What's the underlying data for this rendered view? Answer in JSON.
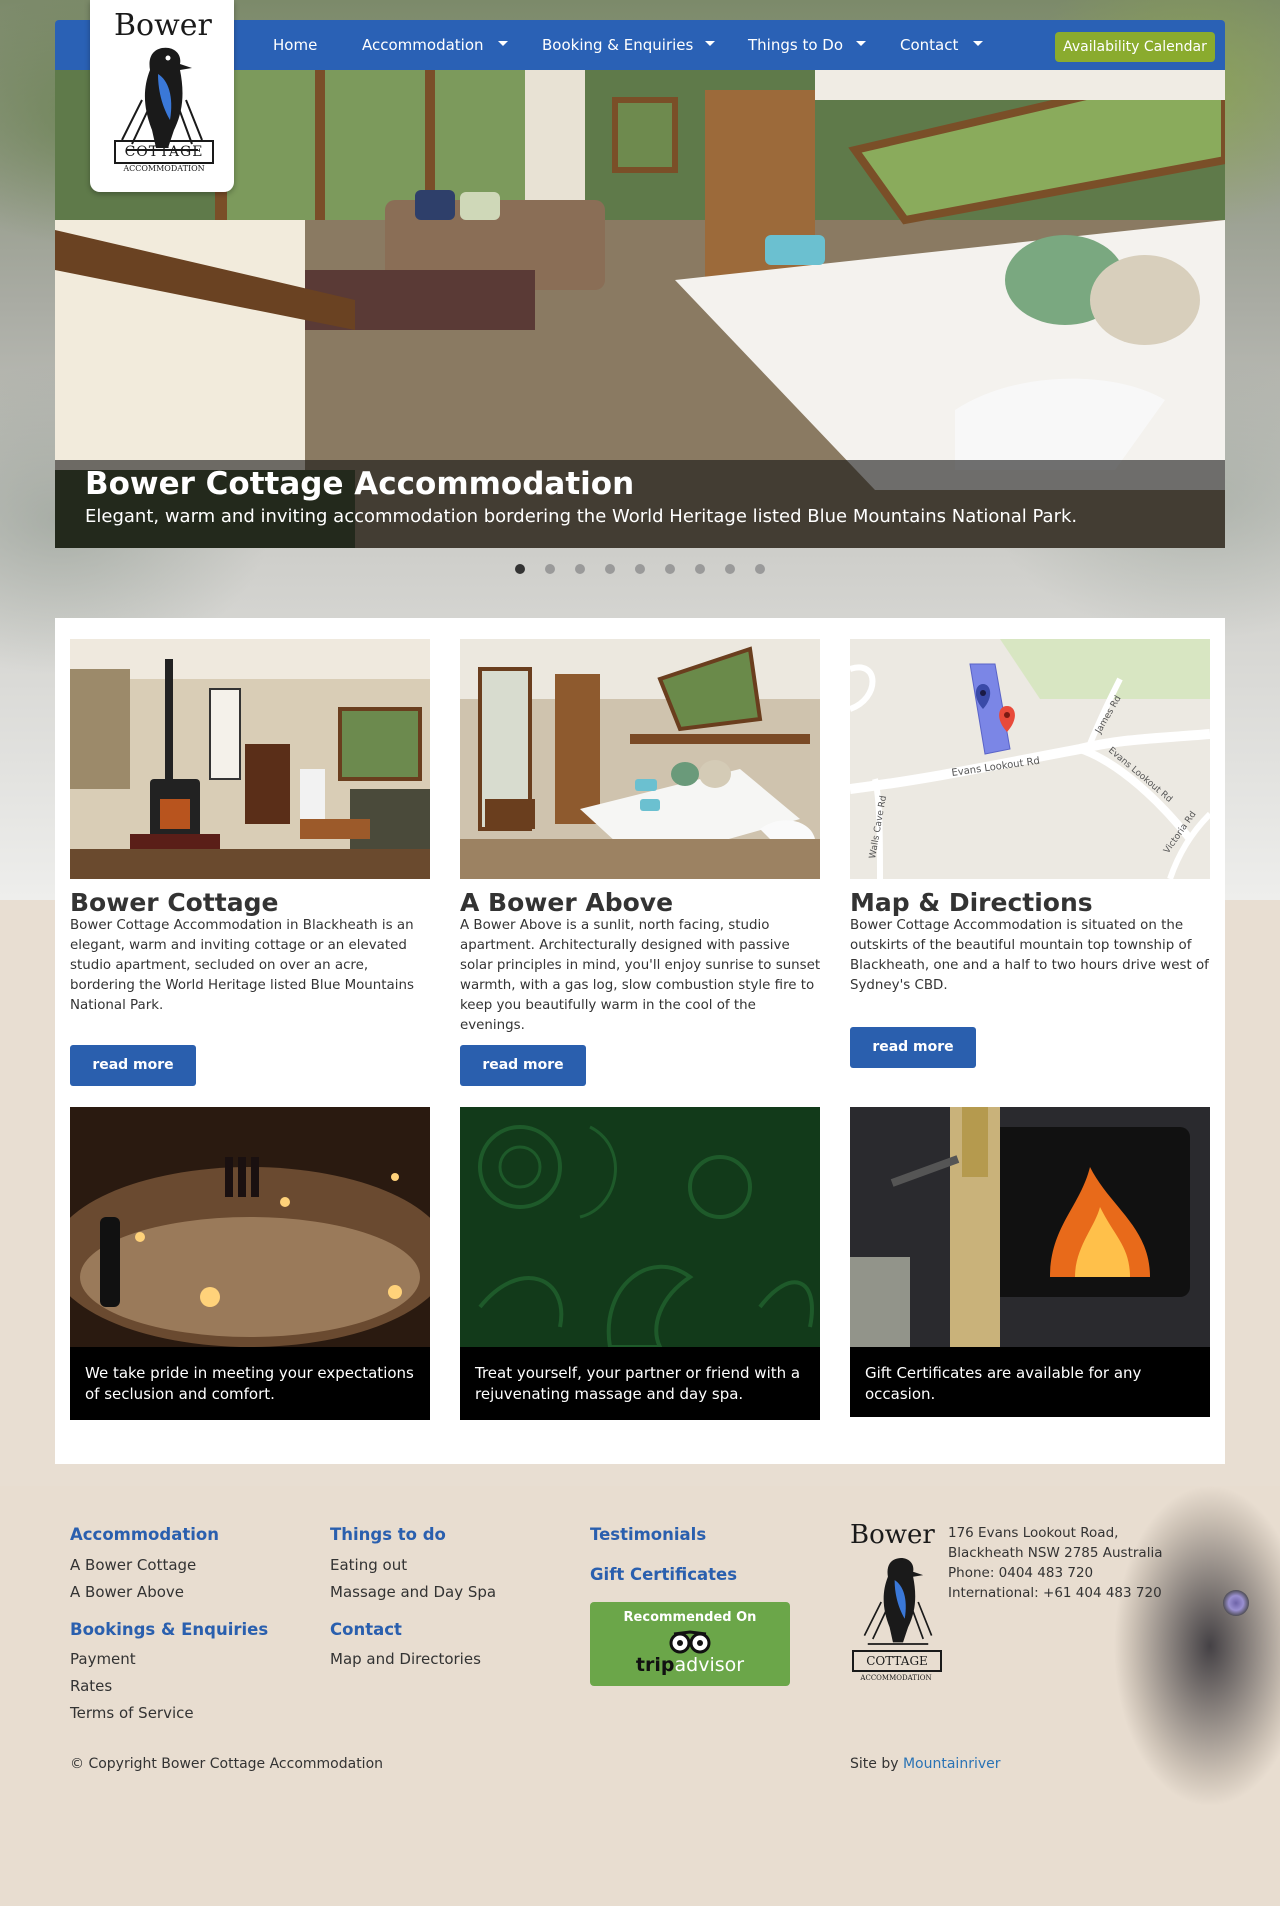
{
  "nav": {
    "items": [
      {
        "label": "Home"
      },
      {
        "label": "Accommodation"
      },
      {
        "label": "Booking & Enquiries"
      },
      {
        "label": "Things to Do"
      },
      {
        "label": "Contact"
      }
    ],
    "availability_button": "Availability Calendar"
  },
  "logo": {
    "word_top": "Bower",
    "word_mid": "COTTAGE",
    "word_bottom": "ACCOMMODATION"
  },
  "hero": {
    "title": "Bower Cottage Accommodation",
    "subtitle": "Elegant, warm and inviting accommodation bordering the World Heritage listed Blue Mountains National Park.",
    "slide_count": 9,
    "active_slide": 1
  },
  "cards": [
    {
      "title": "Bower Cottage",
      "text": "Bower Cottage Accommodation in Blackheath is an elegant, warm and inviting cottage or an elevated studio apartment, secluded on over an acre, bordering the World Heritage listed Blue Mountains National Park.",
      "button": "read more"
    },
    {
      "title": "A Bower Above",
      "text": "A Bower Above is a sunlit, north facing, studio apartment. Architecturally designed with passive solar principles in mind, you'll enjoy sunrise to sunset warmth, with a gas log, slow combustion style fire to keep you beautifully warm in the cool of the evenings.",
      "button": "read more"
    },
    {
      "title": "Map & Directions",
      "text": "Bower Cottage Accommodation is situated on the outskirts of the beautiful mountain top township of Blackheath, one and a half to two hours drive west of Sydney's CBD.",
      "button": "read more"
    }
  ],
  "map_labels": {
    "road1": "Evans Lookout Rd",
    "road2": "Evans Lookout Rd",
    "road3": "James Rd",
    "road4": "Walls Cave Rd",
    "road5": "Victoria Rd"
  },
  "promos": [
    {
      "caption": "We take pride in meeting your expectations of seclusion and comfort."
    },
    {
      "caption": "Treat yourself, your partner or friend with a rejuvenating massage and day spa."
    },
    {
      "caption": "Gift Certificates are available for any occasion."
    }
  ],
  "footer": {
    "col1": {
      "head1": "Accommodation",
      "links1": [
        "A Bower Cottage",
        "A Bower Above"
      ],
      "head2": "Bookings & Enquiries",
      "links2": [
        "Payment",
        "Rates",
        "Terms of Service"
      ]
    },
    "col2": {
      "head1": "Things to do",
      "links1": [
        "Eating out",
        "Massage and Day Spa"
      ],
      "head2": "Contact",
      "links2": [
        "Map and Directories"
      ]
    },
    "col3": {
      "head1": "Testimonials",
      "head2": "Gift Certificates",
      "trip_top": "Recommended On",
      "trip_brand_a": "trip",
      "trip_brand_b": "advisor"
    },
    "address": [
      "176 Evans Lookout Road,",
      "Blackheath NSW 2785 Australia",
      "Phone: 0404 483 720",
      "International: +61 404 483 720"
    ],
    "copyright": "© Copyright Bower Cottage Accommodation",
    "siteby_prefix": "Site by",
    "siteby_link": "Mountainriver"
  },
  "colors": {
    "nav_blue": "#2a61b5",
    "accent_green": "#8aab2e",
    "link_blue": "#2a5fae",
    "trip_green": "#6ba649"
  }
}
